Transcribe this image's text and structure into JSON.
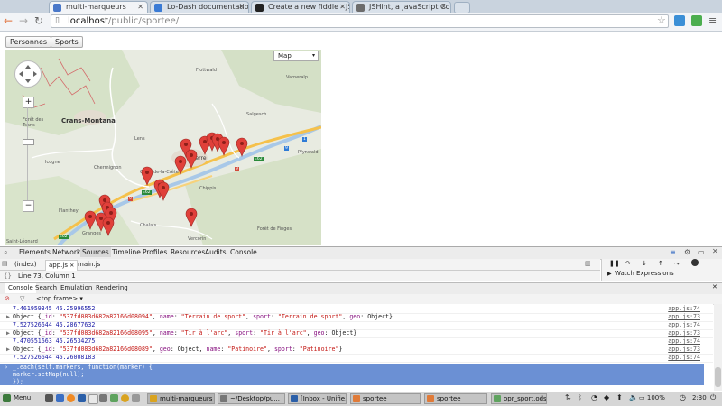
{
  "browser": {
    "tabs": [
      {
        "label": "multi-marqueurs",
        "active": true
      },
      {
        "label": "Lo-Dash documentation",
        "active": false
      },
      {
        "label": "Create a new fiddle - JS",
        "active": false
      },
      {
        "label": "JSHint, a JavaScript Co",
        "active": false
      }
    ],
    "url_host": "localhost",
    "url_path": "/public/sportee/"
  },
  "page": {
    "buttons": [
      "Personnes",
      "Sports"
    ],
    "map": {
      "type_select": "Map",
      "place_labels": [
        "Flottwald",
        "Varneralp",
        "Crans-Montana",
        "Salgesch",
        "Pfynwald",
        "Forêt des Tsans",
        "Lens",
        "Icogne",
        "Chermignon",
        "Chippis",
        "Flanthey",
        "Granges",
        "Chalais",
        "Vercorin",
        "Forêt de Finges",
        "Saint-Léonard",
        "Sierre",
        "Corin-de-la-Crête"
      ],
      "road_shields": [
        "9",
        "1",
        "E62",
        "9",
        "E62",
        "9",
        "E62"
      ],
      "marker_count": 18
    }
  },
  "devtools": {
    "panels": [
      "Elements",
      "Network",
      "Sources",
      "Timeline",
      "Profiles",
      "Resources",
      "Audits",
      "Console"
    ],
    "active_panel": "Sources",
    "files": [
      "(index)",
      "app.js",
      "main.js"
    ],
    "active_file": "app.js",
    "status": "Line 73, Column 1",
    "watch_label": "Watch Expressions",
    "drawer_tabs": [
      "Console",
      "Search",
      "Emulation",
      "Rendering"
    ],
    "frame": "<top frame>",
    "console_lines": [
      {
        "kind": "num",
        "text": "7.461959345 46.25996552",
        "src": "app.js:74"
      },
      {
        "kind": "obj",
        "id": "537fd083d682a82166d08094",
        "order": "name-sport-geo",
        "name": "Terrain de sport",
        "sport": "Terrain de sport",
        "src": "app.js:73"
      },
      {
        "kind": "num",
        "text": "7.527526644 46.28677632",
        "src": "app.js:74"
      },
      {
        "kind": "obj",
        "id": "537fd083d682a82166d08095",
        "order": "name-sport-geo",
        "name": "Tir à l'arc",
        "sport": "Tir à l'arc",
        "src": "app.js:73"
      },
      {
        "kind": "num",
        "text": "7.470551663 46.26534275",
        "src": "app.js:74"
      },
      {
        "kind": "obj",
        "id": "537fd083d682a82166d08089",
        "order": "geo-name-sport",
        "name": "Patinoire",
        "sport": "Patinoire",
        "src": "app.js:73"
      },
      {
        "kind": "num",
        "text": "7.527526644 46.26008183",
        "src": "app.js:74"
      }
    ],
    "command_lines": [
      "_.each(self.markers, function(marker) {",
      "marker.setMap(null);",
      "});"
    ]
  },
  "taskbar": {
    "menu": "Menu",
    "tasks": [
      "multi-marqueurs",
      "~/Desktop/pu...",
      "[Inbox - Unifie...",
      "sportee",
      "sportee",
      "opr_sport.ods ..."
    ],
    "battery": "100%",
    "clock": "2:30"
  },
  "colors": {
    "accent": "#6b90d4",
    "marker": "#e0403a",
    "map_land": "#e7eadf",
    "map_water": "#a8c8e8"
  }
}
